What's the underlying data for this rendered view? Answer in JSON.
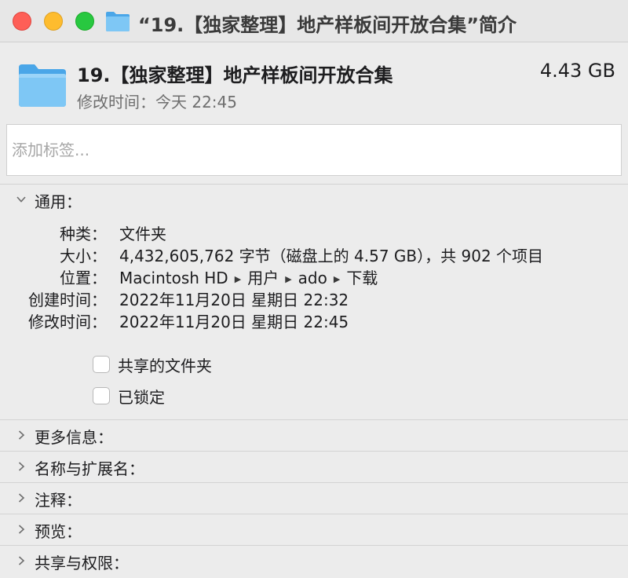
{
  "window": {
    "title": "“19.【独家整理】地产样板间开放合集”简介"
  },
  "colors": {
    "folder_light": "#7ec7f5",
    "folder_dark": "#4aa6e8",
    "close": "#fe5f57",
    "minimize": "#febc2e",
    "maximize": "#28c840"
  },
  "header": {
    "name": "19.【独家整理】地产样板间开放合集",
    "size": "4.43 GB",
    "modified_label": "修改时间：",
    "modified_value": "今天 22:45",
    "icon": "folder-icon"
  },
  "tags": {
    "placeholder": "添加标签..."
  },
  "general": {
    "label": "通用：",
    "expanded": true,
    "rows": [
      {
        "key": "种类：",
        "value": "文件夹"
      },
      {
        "key": "大小：",
        "value": "4,432,605,762 字节（磁盘上的 4.57 GB），共 902 个项目"
      },
      {
        "key": "位置：",
        "path": [
          "Macintosh HD",
          "用户",
          "ado",
          "下载"
        ]
      },
      {
        "key": "创建时间：",
        "value": "2022年11月20日 星期日 22:32"
      },
      {
        "key": "修改时间：",
        "value": "2022年11月20日 星期日 22:45"
      }
    ],
    "checkboxes": [
      {
        "label": "共享的文件夹",
        "checked": false
      },
      {
        "label": "已锁定",
        "checked": false
      }
    ]
  },
  "sections": [
    {
      "label": "更多信息：",
      "expanded": false
    },
    {
      "label": "名称与扩展名：",
      "expanded": false
    },
    {
      "label": "注释：",
      "expanded": false
    },
    {
      "label": "预览：",
      "expanded": false
    },
    {
      "label": "共享与权限：",
      "expanded": false
    }
  ]
}
